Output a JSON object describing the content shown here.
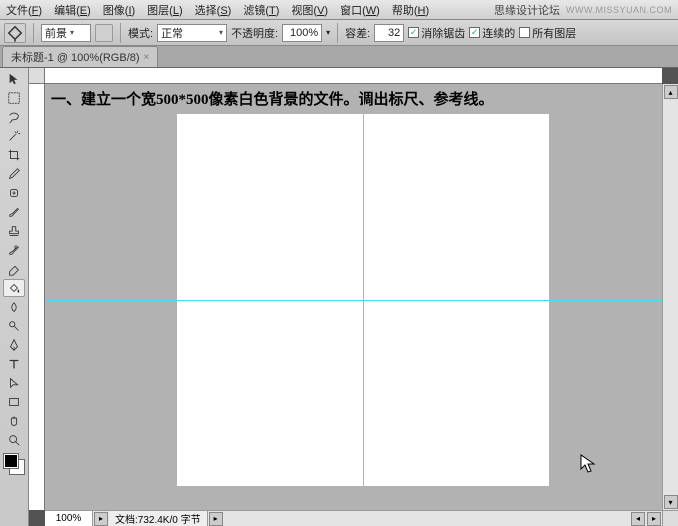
{
  "menu": {
    "items": [
      {
        "label": "文件",
        "key": "F"
      },
      {
        "label": "编辑",
        "key": "E"
      },
      {
        "label": "图像",
        "key": "I"
      },
      {
        "label": "图层",
        "key": "L"
      },
      {
        "label": "选择",
        "key": "S"
      },
      {
        "label": "滤镜",
        "key": "T"
      },
      {
        "label": "视图",
        "key": "V"
      },
      {
        "label": "窗口",
        "key": "W"
      },
      {
        "label": "帮助",
        "key": "H"
      }
    ],
    "brand": "思缘设计论坛",
    "url": "WWW.MISSYUAN.COM"
  },
  "options": {
    "fill_label": "前景",
    "mode_label": "模式:",
    "mode_value": "正常",
    "opacity_label": "不透明度:",
    "opacity_value": "100%",
    "tolerance_label": "容差:",
    "tolerance_value": "32",
    "antialias": {
      "label": "消除锯齿",
      "checked": true
    },
    "contiguous": {
      "label": "连续的",
      "checked": true
    },
    "all_layers": {
      "label": "所有图层",
      "checked": false
    }
  },
  "tab": {
    "title": "未标题-1 @ 100%(RGB/8)"
  },
  "tools": {
    "items": [
      "move",
      "marquee",
      "lasso",
      "wand",
      "crop",
      "eyedropper",
      "healing",
      "brush",
      "stamp",
      "history-brush",
      "eraser",
      "bucket",
      "blur",
      "dodge",
      "pen",
      "text",
      "path-select",
      "shape",
      "hand",
      "zoom"
    ],
    "selected": "bucket"
  },
  "annotation": "一、建立一个宽500*500像素白色背景的文件。调出标尺、参考线。",
  "status": {
    "zoom": "100%",
    "docinfo": "文档:732.4K/0 字节"
  },
  "colors": {
    "guide": "#44ddff",
    "canvas_bg": "#b2b2b2"
  }
}
